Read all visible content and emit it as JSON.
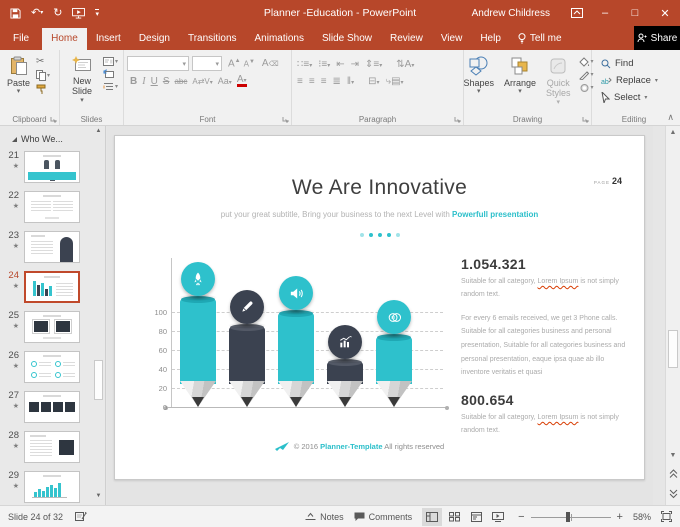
{
  "titlebar": {
    "title": "Planner -Education  -  PowerPoint",
    "user": "Andrew Childress"
  },
  "active_tab": "Home",
  "tabs": [
    "File",
    "Home",
    "Insert",
    "Design",
    "Transitions",
    "Animations",
    "Slide Show",
    "Review",
    "View",
    "Help"
  ],
  "tellme": "Tell me",
  "share": "Share",
  "ribbon": {
    "groups": [
      "Clipboard",
      "Slides",
      "Font",
      "Paragraph",
      "Drawing",
      "Editing"
    ],
    "paste": "Paste",
    "new_slide": "New Slide",
    "shapes": "Shapes",
    "arrange": "Arrange",
    "quick_styles": "Quick Styles",
    "find": "Find",
    "replace": "Replace",
    "select": "Select"
  },
  "panel": {
    "section_title": "Who We...",
    "selected": "24",
    "slides": [
      {
        "num": "21",
        "kind": "team-banner"
      },
      {
        "num": "22",
        "kind": "text-cols"
      },
      {
        "num": "23",
        "kind": "silhouette"
      },
      {
        "num": "24",
        "kind": "chart"
      },
      {
        "num": "25",
        "kind": "two-boxes"
      },
      {
        "num": "26",
        "kind": "teal-badges"
      },
      {
        "num": "27",
        "kind": "four-boxes"
      },
      {
        "num": "28",
        "kind": "text-box"
      },
      {
        "num": "29",
        "kind": "teal-bars"
      }
    ]
  },
  "slide": {
    "page_label": "PAGE",
    "page_number": "24",
    "title": "We Are Innovative",
    "subtitle_text": "put your great subtitle, Bring your business to the next Level with ",
    "subtitle_accent": "Powerfull presentation",
    "stat1_value": "1.054.321",
    "stat2_value": "800.654",
    "caption_pre": "Suitable for all category, ",
    "caption_link": "Lorem Ipsum",
    "caption_post": " is not simply random text.",
    "body": "For every 6 emails received, we get 3 Phone calls. Suitable for all categories business and personal presentation, Suitable for all categories business and personal presentation, eaque ipsa quae ab illo inventore veritatis et quasi",
    "footer_prefix": "© 2016 ",
    "footer_brand": "Planner-Template",
    "footer_suffix": " All rights reserved"
  },
  "chart_data": {
    "type": "bar",
    "categories": [
      "rocket",
      "pencil",
      "megaphone",
      "analytics",
      "coins"
    ],
    "values": [
      115,
      85,
      100,
      48,
      75
    ],
    "colors": [
      "#2EC1CC",
      "#3B4250",
      "#2EC1CC",
      "#3B4250",
      "#2EC1CC"
    ],
    "cap_colors": [
      "#1fa6b2",
      "#545b67",
      "#1fa6b2",
      "#545b67",
      "#1fa6b2"
    ],
    "yticks": [
      0,
      20,
      40,
      60,
      80,
      100
    ],
    "ylim": [
      0,
      120
    ],
    "grid": "dashed-horizontal",
    "legend": "none",
    "title": "",
    "xlabel": "",
    "ylabel": ""
  },
  "statusbar": {
    "slide_info": "Slide 24 of 32",
    "notes": "Notes",
    "comments": "Comments",
    "zoom": "58%"
  },
  "colors": {
    "accent_red": "#B7472A",
    "teal": "#2EC1CC",
    "dark": "#3B4250"
  }
}
